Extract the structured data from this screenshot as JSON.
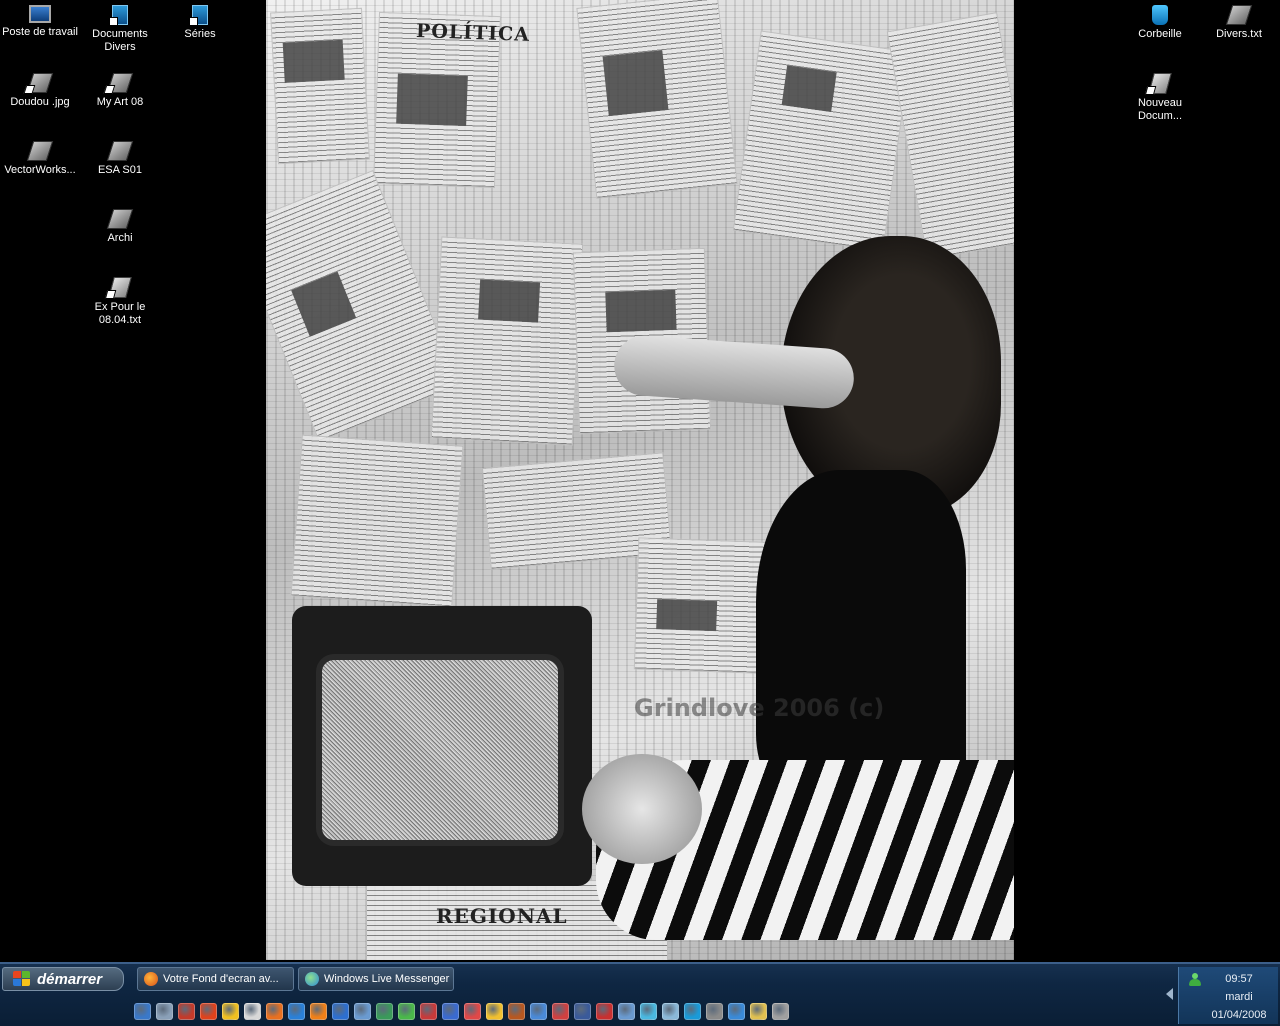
{
  "desktop": {
    "icons_left": [
      {
        "label": "Poste de travail",
        "icon": "computer-icon"
      },
      {
        "label": "Documents Divers",
        "icon": "folder-icon"
      },
      {
        "label": "Séries",
        "icon": "folder-icon"
      },
      {
        "label": "Doudou .jpg",
        "icon": "image-file-icon"
      },
      {
        "label": "My Art 08",
        "icon": "folder-shortcut-icon"
      },
      {
        "label": "VectorWorks...",
        "icon": "application-icon"
      },
      {
        "label": "ESA S01",
        "icon": "folder-icon"
      },
      {
        "label": "Archi",
        "icon": "folder-icon"
      },
      {
        "label": "Ex Pour le 08.04.txt",
        "icon": "text-file-icon"
      }
    ],
    "icons_right": [
      {
        "label": "Corbeille",
        "icon": "recycle-bin-icon"
      },
      {
        "label": "Divers.txt",
        "icon": "text-file-icon"
      },
      {
        "label": "Nouveau Docum...",
        "icon": "text-file-icon"
      }
    ],
    "wallpaper": {
      "headline_politica": "POLÍTICA",
      "headline_regional": "REGIONAL",
      "watermark": "Grindlove 2006 (c)"
    }
  },
  "taskbar": {
    "start_label": "démarrer",
    "tasks": [
      {
        "label": "Votre Fond d'ecran av...",
        "icon": "firefox-icon"
      },
      {
        "label": "Windows Live Messenger",
        "icon": "messenger-icon"
      }
    ],
    "quick_launch_colors": [
      "#3a78c8",
      "#8aa0b8",
      "#c43a2a",
      "#e0421c",
      "#f0c020",
      "#d8d8d8",
      "#e87020",
      "#2a80d8",
      "#f08018",
      "#2d6fd0",
      "#6a9ad0",
      "#3a9a5a",
      "#4ab84a",
      "#c83a3a",
      "#3a6ad0",
      "#e04848",
      "#f0c030",
      "#b85820",
      "#4a8ad8",
      "#d04040",
      "#3a5a9a",
      "#c83030",
      "#6a9ad0",
      "#4ab8e0",
      "#8ab8d8",
      "#1a9ad8",
      "#8a8a8a",
      "#3a8ad8",
      "#e0c050",
      "#a0a0a0"
    ],
    "clock": {
      "time": "09:57",
      "day": "mardi",
      "date": "01/04/2008"
    }
  }
}
